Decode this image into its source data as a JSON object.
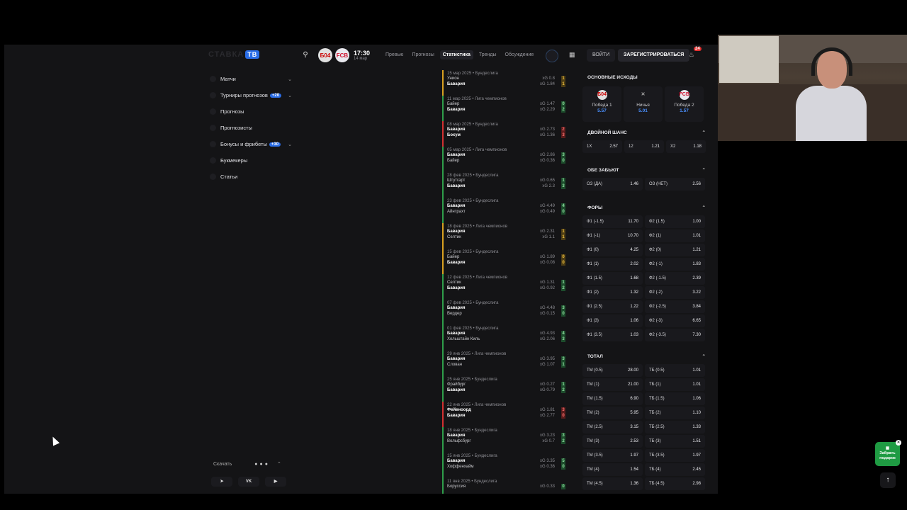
{
  "header": {
    "logo_text": "СТАВКА",
    "logo_badge": "ТВ",
    "match_time": "17:30",
    "match_date": "14 мар",
    "team1_logo": "Б04",
    "team2_logo": "FCB",
    "tabs": [
      {
        "label": "Превью"
      },
      {
        "label": "Прогнозы"
      },
      {
        "label": "Статистика"
      },
      {
        "label": "Тренды"
      },
      {
        "label": "Обсуждение"
      }
    ],
    "login_label": "ВОЙТИ",
    "register_label": "ЗАРЕГИСТРИРОВАТЬСЯ",
    "notifications": "24"
  },
  "sidebar": {
    "items": [
      {
        "label": "Матчи",
        "badge": ""
      },
      {
        "label": "Турниры прогнозов",
        "badge": "+20"
      },
      {
        "label": "Прогнозы",
        "badge": ""
      },
      {
        "label": "Прогнозисты",
        "badge": ""
      },
      {
        "label": "Бонусы и фрибеты",
        "badge": "+30"
      },
      {
        "label": "Букмекеры",
        "badge": ""
      },
      {
        "label": "Статьи",
        "badge": ""
      }
    ],
    "download_label": "Скачать",
    "social": [
      "VK"
    ]
  },
  "matches": [
    {
      "meta": "15 мар 2025 • Бундеслига",
      "t1": "Унион",
      "xg1": "xG 0.8",
      "s1": "1",
      "t2": "Бавария",
      "xg2": "xG 1.84",
      "s2": "1",
      "res": "yellow"
    },
    {
      "meta": "11 мар 2025 • Лига чемпионов",
      "t1": "Байер",
      "xg1": "xG 1.47",
      "s1": "0",
      "t2": "Бавария",
      "xg2": "xG 2.29",
      "s2": "2",
      "res": "green"
    },
    {
      "meta": "08 мар 2025 • Бундеслига",
      "t1": "Бавария",
      "xg1": "xG 2.73",
      "s1": "2",
      "t2": "Бохум",
      "xg2": "xG 1.36",
      "s2": "3",
      "res": "red"
    },
    {
      "meta": "05 мар 2025 • Лига чемпионов",
      "t1": "Бавария",
      "xg1": "xG 2.86",
      "s1": "3",
      "t2": "Байер",
      "xg2": "xG 0.36",
      "s2": "0",
      "res": "green"
    },
    {
      "meta": "28 фев 2025 • Бундеслига",
      "t1": "Штутгарт",
      "xg1": "xG 0.65",
      "s1": "1",
      "t2": "Бавария",
      "xg2": "xG 2.3",
      "s2": "3",
      "res": "green"
    },
    {
      "meta": "23 фев 2025 • Бундеслига",
      "t1": "Бавария",
      "xg1": "xG 4.49",
      "s1": "4",
      "t2": "Айнтрахт",
      "xg2": "xG 0.49",
      "s2": "0",
      "res": "green"
    },
    {
      "meta": "18 фев 2025 • Лига чемпионов",
      "t1": "Бавария",
      "xg1": "xG 2.31",
      "s1": "1",
      "t2": "Селтик",
      "xg2": "xG 1.1",
      "s2": "1",
      "res": "yellow"
    },
    {
      "meta": "15 фев 2025 • Бундеслига",
      "t1": "Байер",
      "xg1": "xG 1.89",
      "s1": "0",
      "t2": "Бавария",
      "xg2": "xG 0.08",
      "s2": "0",
      "res": "yellow"
    },
    {
      "meta": "12 фев 2025 • Лига чемпионов",
      "t1": "Селтик",
      "xg1": "xG 1.31",
      "s1": "1",
      "t2": "Бавария",
      "xg2": "xG 0.92",
      "s2": "2",
      "res": "green"
    },
    {
      "meta": "07 фев 2025 • Бундеслига",
      "t1": "Бавария",
      "xg1": "xG 4.48",
      "s1": "3",
      "t2": "Вердер",
      "xg2": "xG 0.15",
      "s2": "0",
      "res": "green"
    },
    {
      "meta": "01 фев 2025 • Бундеслига",
      "t1": "Бавария",
      "xg1": "xG 4.93",
      "s1": "4",
      "t2": "Хольштайн Киль",
      "xg2": "xG 2.06",
      "s2": "3",
      "res": "green"
    },
    {
      "meta": "29 янв 2025 • Лига чемпионов",
      "t1": "Бавария",
      "xg1": "xG 3.95",
      "s1": "3",
      "t2": "Слован",
      "xg2": "xG 1.07",
      "s2": "1",
      "res": "green"
    },
    {
      "meta": "25 янв 2025 • Бундеслига",
      "t1": "Фрайбург",
      "xg1": "xG 0.27",
      "s1": "1",
      "t2": "Бавария",
      "xg2": "xG 0.79",
      "s2": "2",
      "res": "green"
    },
    {
      "meta": "22 янв 2025 • Лига чемпионов",
      "t1": "Фейеноорд",
      "xg1": "xG 1.81",
      "s1": "3",
      "t2": "Бавария",
      "xg2": "xG 2.77",
      "s2": "0",
      "res": "red"
    },
    {
      "meta": "18 янв 2025 • Бундеслига",
      "t1": "Бавария",
      "xg1": "xG 3.23",
      "s1": "3",
      "t2": "Вольфсбург",
      "xg2": "xG 0.7",
      "s2": "2",
      "res": "green"
    },
    {
      "meta": "15 янв 2025 • Бундеслига",
      "t1": "Бавария",
      "xg1": "xG 3.35",
      "s1": "5",
      "t2": "Хоффенхайм",
      "xg2": "xG 0.36",
      "s2": "0",
      "res": "green"
    },
    {
      "meta": "11 янв 2025 • Бундеслига",
      "t1": "Боруссия",
      "xg1": "xG 0.33",
      "s1": "0",
      "t2": "",
      "xg2": "",
      "s2": "",
      "res": "green"
    }
  ],
  "odds": {
    "main_title": "ОСНОВНЫЕ ИСХОДЫ",
    "outcomes": [
      {
        "label": "Победа 1",
        "value": "5.57"
      },
      {
        "label": "Ничья",
        "value": "5.01"
      },
      {
        "label": "Победа 2",
        "value": "1.57"
      }
    ],
    "double_title": "ДВОЙНОЙ ШАНС",
    "double": [
      {
        "k": "1X",
        "v": "2.57"
      },
      {
        "k": "12",
        "v": "1.21"
      },
      {
        "k": "X2",
        "v": "1.18"
      }
    ],
    "both_title": "ОБЕ ЗАБЬЮТ",
    "both": [
      {
        "k": "ОЗ (ДА)",
        "v": "1.46"
      },
      {
        "k": "ОЗ (НЕТ)",
        "v": "2.56"
      }
    ],
    "handicap_title": "ФОРЫ",
    "handicap": [
      {
        "k": "Ф1 (-1.5)",
        "v": "11.70"
      },
      {
        "k": "Ф2 (1.5)",
        "v": "1.00"
      },
      {
        "k": "Ф1 (-1)",
        "v": "10.70"
      },
      {
        "k": "Ф2 (1)",
        "v": "1.01"
      },
      {
        "k": "Ф1 (0)",
        "v": "4.25"
      },
      {
        "k": "Ф2 (0)",
        "v": "1.21"
      },
      {
        "k": "Ф1 (1)",
        "v": "2.02"
      },
      {
        "k": "Ф2 (-1)",
        "v": "1.83"
      },
      {
        "k": "Ф1 (1.5)",
        "v": "1.68"
      },
      {
        "k": "Ф2 (-1.5)",
        "v": "2.39"
      },
      {
        "k": "Ф1 (2)",
        "v": "1.32"
      },
      {
        "k": "Ф2 (-2)",
        "v": "3.22"
      },
      {
        "k": "Ф1 (2.5)",
        "v": "1.22"
      },
      {
        "k": "Ф2 (-2.5)",
        "v": "3.84"
      },
      {
        "k": "Ф1 (3)",
        "v": "1.06"
      },
      {
        "k": "Ф2 (-3)",
        "v": "6.65"
      },
      {
        "k": "Ф1 (3.5)",
        "v": "1.03"
      },
      {
        "k": "Ф2 (-3.5)",
        "v": "7.30"
      }
    ],
    "total_title": "ТОТАЛ",
    "total": [
      {
        "k": "ТМ (0.5)",
        "v": "28.00"
      },
      {
        "k": "ТБ (0.5)",
        "v": "1.01"
      },
      {
        "k": "ТМ (1)",
        "v": "21.00"
      },
      {
        "k": "ТБ (1)",
        "v": "1.01"
      },
      {
        "k": "ТМ (1.5)",
        "v": "6.90"
      },
      {
        "k": "ТБ (1.5)",
        "v": "1.06"
      },
      {
        "k": "ТМ (2)",
        "v": "5.95"
      },
      {
        "k": "ТБ (2)",
        "v": "1.10"
      },
      {
        "k": "ТМ (2.5)",
        "v": "3.15"
      },
      {
        "k": "ТБ (2.5)",
        "v": "1.33"
      },
      {
        "k": "ТМ (3)",
        "v": "2.53"
      },
      {
        "k": "ТБ (3)",
        "v": "1.51"
      },
      {
        "k": "ТМ (3.5)",
        "v": "1.97"
      },
      {
        "k": "ТБ (3.5)",
        "v": "1.97"
      },
      {
        "k": "ТМ (4)",
        "v": "1.54"
      },
      {
        "k": "ТБ (4)",
        "v": "2.45"
      },
      {
        "k": "ТМ (4.5)",
        "v": "1.36"
      },
      {
        "k": "ТБ (4.5)",
        "v": "2.98"
      }
    ]
  },
  "gift_widget": {
    "label": "Забрать подарок"
  }
}
